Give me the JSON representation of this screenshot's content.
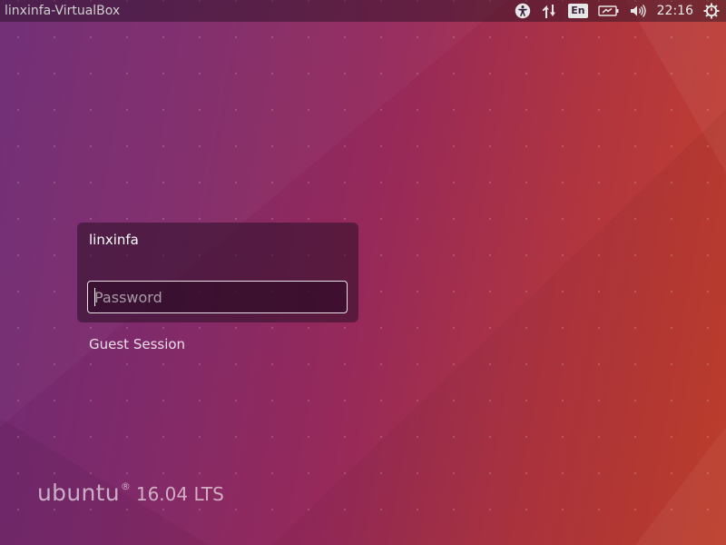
{
  "panel": {
    "hostname": "linxinfa-VirtualBox",
    "language": "En",
    "clock": "22:16",
    "icons": [
      "accessibility-icon",
      "network-icon",
      "keyboard-language-icon",
      "battery-icon",
      "volume-icon",
      "power-gear-icon"
    ]
  },
  "login": {
    "username": "linxinfa",
    "password_placeholder": "Password",
    "guest_session": "Guest Session"
  },
  "branding": {
    "wordmark": "ubuntu",
    "registered_mark": "®",
    "version": "16.04 LTS"
  },
  "colors": {
    "background_left": "#6e2a73",
    "background_right": "#c4402c",
    "panel": "#1e0e1e",
    "login_box": "#2a0e26"
  }
}
